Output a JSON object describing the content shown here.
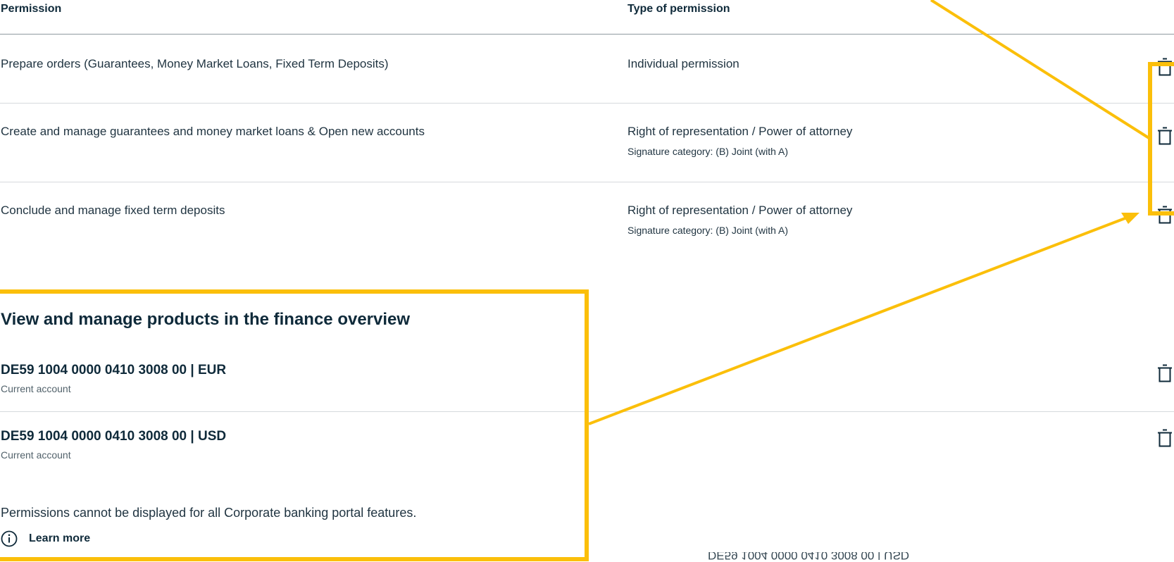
{
  "table": {
    "header_permission": "Permission",
    "header_type": "Type of permission",
    "rows": [
      {
        "permission": "Prepare orders (Guarantees, Money Market Loans, Fixed Term Deposits)",
        "type": "Individual permission",
        "signature": ""
      },
      {
        "permission": "Create and manage guarantees and money market loans & Open new accounts",
        "type": "Right of representation / Power of attorney",
        "signature": "Signature category: (B) Joint (with A)"
      },
      {
        "permission": "Conclude and manage fixed term deposits",
        "type": "Right of representation / Power of attorney",
        "signature": "Signature category: (B) Joint (with A)"
      }
    ]
  },
  "finance": {
    "title": "View and manage products in the finance overview",
    "accounts": [
      {
        "number": "DE59 1004 0000 0410 3008 00 | EUR",
        "kind": "Current account"
      },
      {
        "number": "DE59 1004 0000 0410 3008 00 | USD",
        "kind": "Current account"
      }
    ],
    "note": "Permissions cannot be displayed for all Corporate banking portal features.",
    "learn_more": "Learn more"
  },
  "mirrored_text": "DE59 1004 0000 0410 3008 00 | USD",
  "colors": {
    "highlight": "#fbbf0a",
    "text": "#0f2a3a",
    "divider": "#d6dadd"
  },
  "icons": {
    "delete": "trash-icon",
    "info": "info-circle-icon"
  }
}
